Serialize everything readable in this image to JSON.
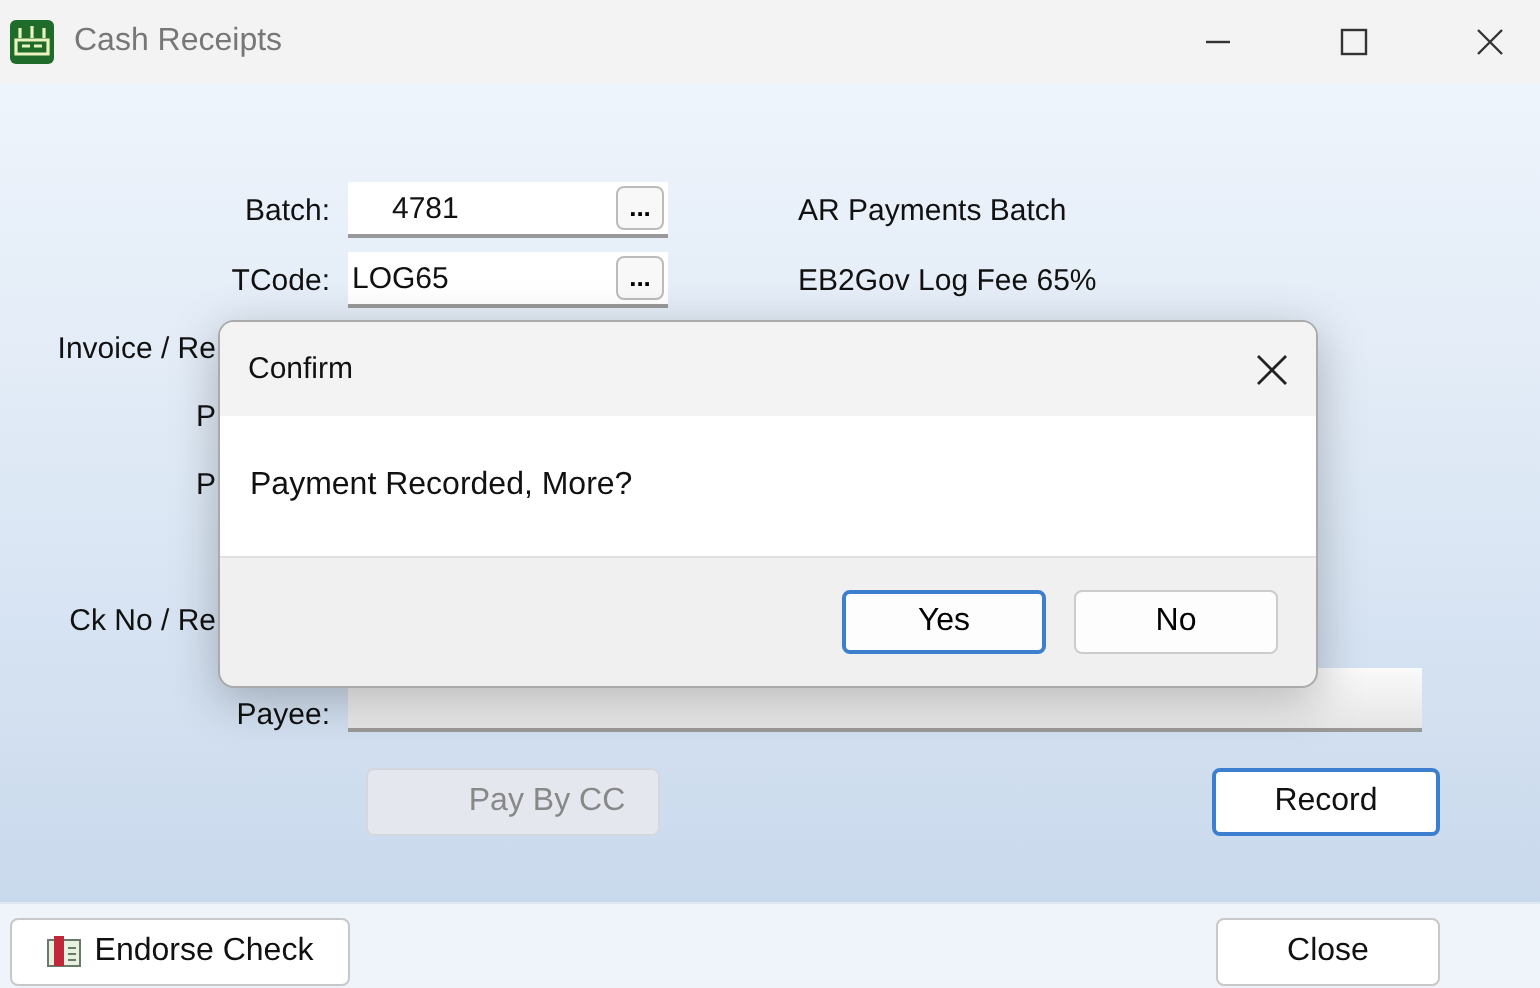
{
  "window": {
    "title": "Cash Receipts"
  },
  "form": {
    "batch": {
      "label": "Batch:",
      "value": "4781",
      "browse": "...",
      "description": "AR Payments Batch"
    },
    "tcode": {
      "label": "TCode:",
      "value": "LOG65",
      "browse": "...",
      "description": "EB2Gov Log Fee 65%"
    },
    "covered_labels": [
      "Invoice / Re",
      "P",
      "P",
      "Ck No / Re"
    ],
    "payee": {
      "label": "Payee:"
    },
    "pay_by_cc": {
      "label": "Pay By CC",
      "disabled": true
    },
    "record": {
      "label": "Record",
      "disabled": false
    }
  },
  "footer": {
    "endorse": "Endorse Check",
    "close": "Close"
  },
  "dialog": {
    "title": "Confirm",
    "message": "Payment Recorded, More?",
    "buttons": [
      {
        "label": "Yes",
        "default": true
      },
      {
        "label": "No",
        "default": false
      }
    ]
  }
}
